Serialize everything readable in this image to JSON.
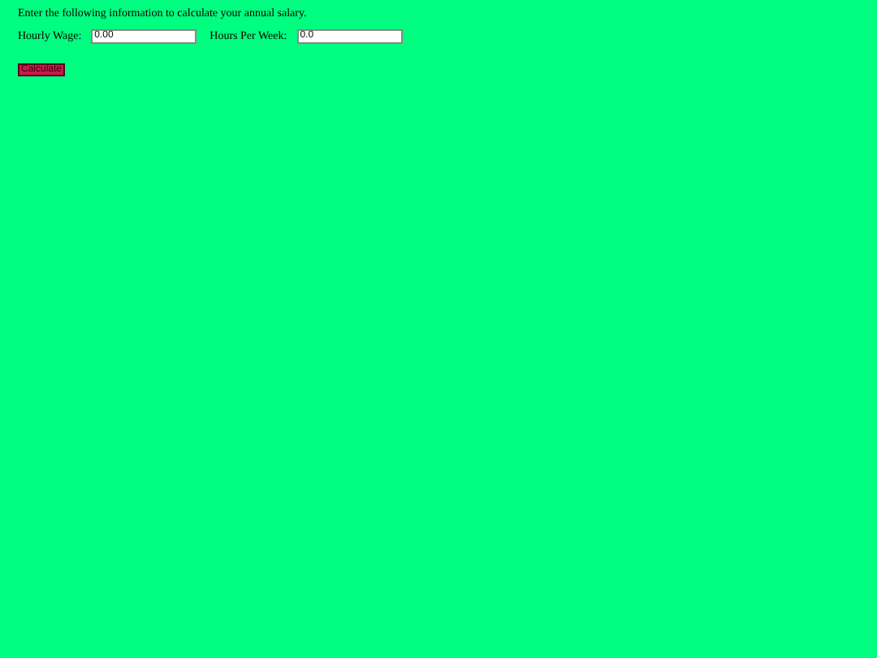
{
  "instructions": "Enter the following information to calculate your annual salary.",
  "fields": [
    {
      "label": "Hourly Wage:",
      "value": "0.00"
    },
    {
      "label": "Hours Per Week:",
      "value": "0.0"
    }
  ],
  "button": "Calculate"
}
